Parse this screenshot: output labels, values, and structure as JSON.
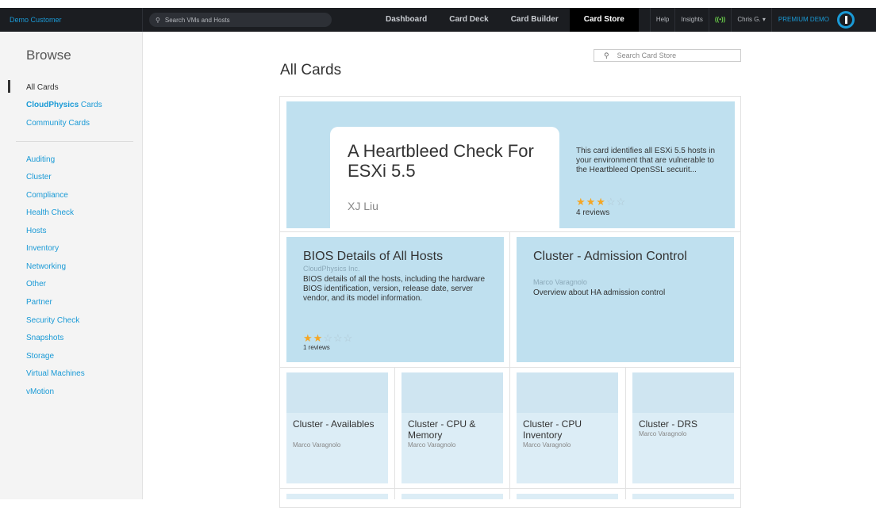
{
  "topbar": {
    "customer": "Demo Customer",
    "search_placeholder": "Search VMs and Hosts",
    "nav": [
      "Dashboard",
      "Card Deck",
      "Card Builder",
      "Card Store"
    ],
    "help": "Help",
    "insights": "Insights",
    "signal": "((•))",
    "user": "Chris G. ▾",
    "plan": "PREMIUM DEMO"
  },
  "sidebar": {
    "title": "Browse",
    "all_cards": "All Cards",
    "cp_cards_bold": "CloudPhysics",
    "cp_cards_rest": " Cards",
    "community": "Community Cards",
    "categories": [
      "Auditing",
      "Cluster",
      "Compliance",
      "Health Check",
      "Hosts",
      "Inventory",
      "Networking",
      "Other",
      "Partner",
      "Security Check",
      "Snapshots",
      "Storage",
      "Virtual Machines",
      "vMotion"
    ]
  },
  "main": {
    "title": "All Cards",
    "search_placeholder": "Search Card Store"
  },
  "featured": {
    "title": "A Heartbleed Check For ESXi 5.5",
    "author": "XJ Liu",
    "description": "This card identifies all ESXi 5.5 hosts in your environment that are vulnerable to the Heartbleed OpenSSL securit...",
    "stars_on": "★★★",
    "stars_off": "☆☆",
    "reviews": "4 reviews"
  },
  "medium_cards": [
    {
      "title": "BIOS Details of All Hosts",
      "author": "CloudPhysics Inc.",
      "description": "BIOS details of all the hosts, including the hardware BIOS identification, version, release date, server vendor, and its model information.",
      "stars_on": "★★",
      "stars_off": "☆☆☆",
      "reviews": "1 reviews"
    },
    {
      "title": "Cluster - Admission Control",
      "author": "Marco Varagnolo",
      "description": "Overview about HA admission control"
    }
  ],
  "small_cards": [
    {
      "title": "Cluster - Availables",
      "author": "Marco Varagnolo"
    },
    {
      "title": "Cluster - CPU & Memory",
      "author": "Marco Varagnolo"
    },
    {
      "title": "Cluster - CPU Inventory",
      "author": "Marco Varagnolo"
    },
    {
      "title": "Cluster - DRS",
      "author": "Marco Varagnolo"
    }
  ]
}
